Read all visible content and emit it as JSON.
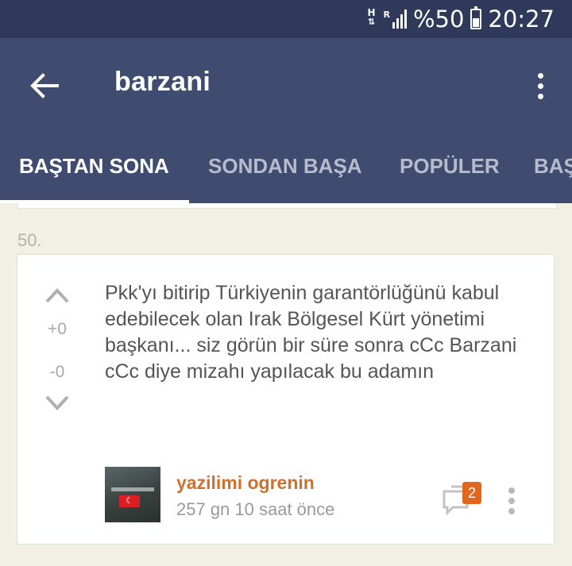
{
  "status_bar": {
    "network_top": "H",
    "network_arrows": "⇅",
    "roaming": "R",
    "battery_percent": "%50",
    "time": "20:27",
    "icons": [
      "network-type-icon",
      "signal-icon",
      "battery-icon"
    ]
  },
  "app_bar": {
    "title": "barzani",
    "back_icon": "arrow-left-icon",
    "menu_icon": "more-vertical-icon",
    "background": "#3f4c70"
  },
  "tabs": [
    {
      "label": "BAŞTAN SONA",
      "active": true
    },
    {
      "label": "SONDAN BAŞA",
      "active": false
    },
    {
      "label": "POPÜLER",
      "active": false
    },
    {
      "label": "BAŞ",
      "active": false
    }
  ],
  "entry": {
    "index": "50.",
    "upvote_count": "+0",
    "downvote_count": "-0",
    "text": "Pkk'yı bitirip Türkiyenin garantörlüğünü kabul edebilecek olan Irak Bölgesel Kürt yönetimi başkanı... siz görün bir süre sonra cCc Barzani cCc diye mizahı yapılacak bu adamın",
    "author": "yazilimi ogrenin",
    "time": "257 gn 10 saat  önce",
    "comment_count": "2",
    "author_color": "#d2702a",
    "badge_color": "#e0671d"
  }
}
